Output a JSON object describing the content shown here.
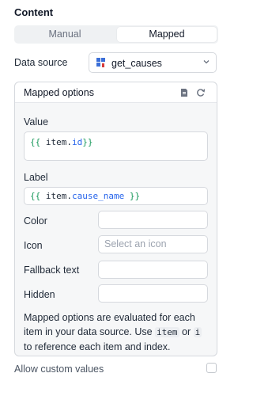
{
  "section_title": "Content",
  "segment": {
    "manual_label": "Manual",
    "mapped_label": "Mapped",
    "selected": "Mapped"
  },
  "data_source": {
    "label": "Data source",
    "value": "get_causes",
    "icon": "query-icon"
  },
  "mapped_options": {
    "title": "Mapped options",
    "value_field": {
      "label": "Value",
      "code_open": "{{",
      "code_obj": " item.",
      "code_prop": "id",
      "code_close": "}}"
    },
    "label_field": {
      "label": "Label",
      "code_open": "{{",
      "code_obj": " item.",
      "code_prop": "cause_name",
      "code_close": " }}"
    },
    "color": {
      "label": "Color",
      "value": ""
    },
    "icon": {
      "label": "Icon",
      "placeholder": "Select an icon"
    },
    "fallback": {
      "label": "Fallback text",
      "value": ""
    },
    "hidden": {
      "label": "Hidden",
      "value": ""
    },
    "note": {
      "part1": "Mapped options are evaluated for each item in your data source. Use ",
      "code1": "item",
      "part2": " or ",
      "code2": "i",
      "part3": " to reference each item and index."
    }
  },
  "allow_custom": {
    "label": "Allow custom values",
    "checked": false
  },
  "colors": {
    "brace": "#17985a",
    "prop": "#2563eb",
    "border": "#d6d9de"
  }
}
